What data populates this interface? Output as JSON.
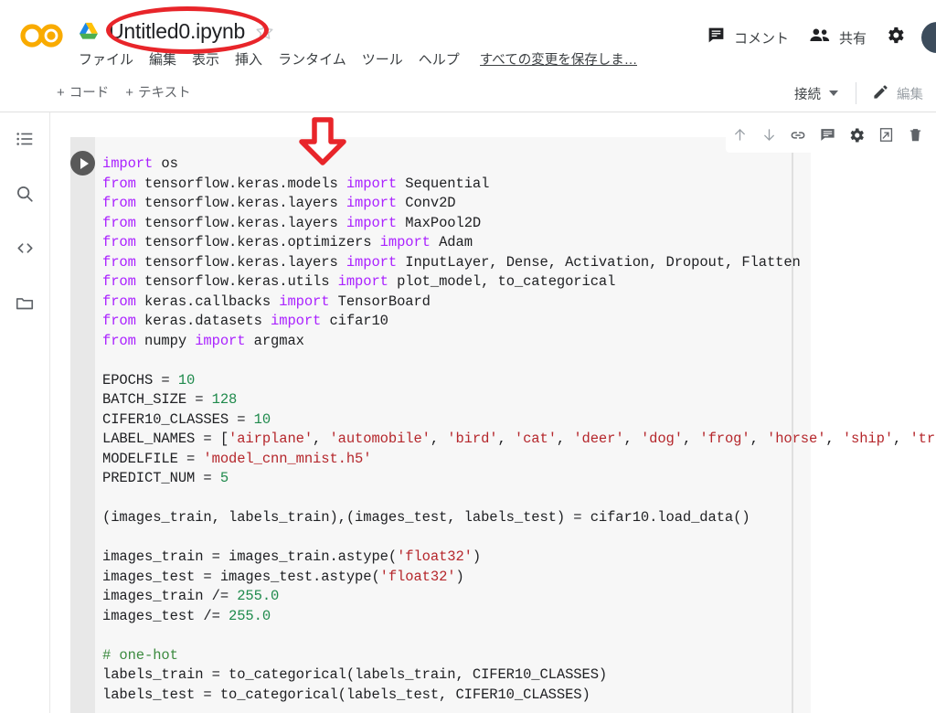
{
  "app": {
    "name": "Google Colaboratory",
    "logo_text": "CO"
  },
  "header": {
    "document_title": "Untitled0.ipynb",
    "drive_icon": "google-drive-icon",
    "star_icon": "star-outline-icon",
    "menu_items": [
      {
        "label": "ファイル"
      },
      {
        "label": "編集"
      },
      {
        "label": "表示"
      },
      {
        "label": "挿入"
      },
      {
        "label": "ランタイム"
      },
      {
        "label": "ツール"
      },
      {
        "label": "ヘルプ"
      }
    ],
    "save_status": "すべての変更を保存しま…",
    "comment_label": "コメント",
    "comment_icon": "comment-icon",
    "share_label": "共有",
    "share_icon": "people-icon",
    "settings_icon": "gear-icon",
    "avatar": "user-avatar"
  },
  "toolbar": {
    "add_code_label": "コード",
    "add_text_label": "テキスト",
    "plus": "+",
    "connect_label": "接続",
    "connect_caret": "chevron-down-icon",
    "edit_label": "編集",
    "edit_icon": "pencil-icon"
  },
  "sidebar": {
    "items": [
      {
        "name": "table-of-contents",
        "icon": "list-icon"
      },
      {
        "name": "find-and-replace",
        "icon": "search-icon"
      },
      {
        "name": "code-snippets",
        "icon": "code-brackets-icon"
      },
      {
        "name": "files",
        "icon": "folder-icon"
      }
    ]
  },
  "cell_toolbar": {
    "buttons": [
      {
        "name": "move-cell-up",
        "icon": "arrow-up-icon"
      },
      {
        "name": "move-cell-down",
        "icon": "arrow-down-icon"
      },
      {
        "name": "link-to-cell",
        "icon": "link-icon"
      },
      {
        "name": "add-comment",
        "icon": "comment-icon"
      },
      {
        "name": "cell-settings",
        "icon": "gear-icon"
      },
      {
        "name": "open-in-new-tab",
        "icon": "open-in-new-icon"
      },
      {
        "name": "delete-cell",
        "icon": "trash-icon"
      }
    ]
  },
  "cell": {
    "run_button": "run-cell-button",
    "code_lines": [
      [
        {
          "t": "import",
          "c": "kw"
        },
        {
          "t": " os",
          "c": ""
        }
      ],
      [
        {
          "t": "from",
          "c": "kw"
        },
        {
          "t": " tensorflow.keras.models ",
          "c": ""
        },
        {
          "t": "import",
          "c": "kw"
        },
        {
          "t": " Sequential",
          "c": ""
        }
      ],
      [
        {
          "t": "from",
          "c": "kw"
        },
        {
          "t": " tensorflow.keras.layers ",
          "c": ""
        },
        {
          "t": "import",
          "c": "kw"
        },
        {
          "t": " Conv2D",
          "c": ""
        }
      ],
      [
        {
          "t": "from",
          "c": "kw"
        },
        {
          "t": " tensorflow.keras.layers ",
          "c": ""
        },
        {
          "t": "import",
          "c": "kw"
        },
        {
          "t": " MaxPool2D",
          "c": ""
        }
      ],
      [
        {
          "t": "from",
          "c": "kw"
        },
        {
          "t": " tensorflow.keras.optimizers ",
          "c": ""
        },
        {
          "t": "import",
          "c": "kw"
        },
        {
          "t": " Adam",
          "c": ""
        }
      ],
      [
        {
          "t": "from",
          "c": "kw"
        },
        {
          "t": " tensorflow.keras.layers ",
          "c": ""
        },
        {
          "t": "import",
          "c": "kw"
        },
        {
          "t": " InputLayer, Dense, Activation, Dropout, Flatten",
          "c": ""
        }
      ],
      [
        {
          "t": "from",
          "c": "kw"
        },
        {
          "t": " tensorflow.keras.utils ",
          "c": ""
        },
        {
          "t": "import",
          "c": "kw"
        },
        {
          "t": " plot_model, to_categorical",
          "c": ""
        }
      ],
      [
        {
          "t": "from",
          "c": "kw"
        },
        {
          "t": " keras.callbacks ",
          "c": ""
        },
        {
          "t": "import",
          "c": "kw"
        },
        {
          "t": " TensorBoard",
          "c": ""
        }
      ],
      [
        {
          "t": "from",
          "c": "kw"
        },
        {
          "t": " keras.datasets ",
          "c": ""
        },
        {
          "t": "import",
          "c": "kw"
        },
        {
          "t": " cifar10",
          "c": ""
        }
      ],
      [
        {
          "t": "from",
          "c": "kw"
        },
        {
          "t": " numpy ",
          "c": ""
        },
        {
          "t": "import",
          "c": "kw"
        },
        {
          "t": " argmax",
          "c": ""
        }
      ],
      [
        {
          "t": "",
          "c": ""
        }
      ],
      [
        {
          "t": "EPOCHS = ",
          "c": ""
        },
        {
          "t": "10",
          "c": "num"
        }
      ],
      [
        {
          "t": "BATCH_SIZE = ",
          "c": ""
        },
        {
          "t": "128",
          "c": "num"
        }
      ],
      [
        {
          "t": "CIFER10_CLASSES = ",
          "c": ""
        },
        {
          "t": "10",
          "c": "num"
        }
      ],
      [
        {
          "t": "LABEL_NAMES = [",
          "c": ""
        },
        {
          "t": "'airplane'",
          "c": "str"
        },
        {
          "t": ", ",
          "c": ""
        },
        {
          "t": "'automobile'",
          "c": "str"
        },
        {
          "t": ", ",
          "c": ""
        },
        {
          "t": "'bird'",
          "c": "str"
        },
        {
          "t": ", ",
          "c": ""
        },
        {
          "t": "'cat'",
          "c": "str"
        },
        {
          "t": ", ",
          "c": ""
        },
        {
          "t": "'deer'",
          "c": "str"
        },
        {
          "t": ", ",
          "c": ""
        },
        {
          "t": "'dog'",
          "c": "str"
        },
        {
          "t": ", ",
          "c": ""
        },
        {
          "t": "'frog'",
          "c": "str"
        },
        {
          "t": ", ",
          "c": ""
        },
        {
          "t": "'horse'",
          "c": "str"
        },
        {
          "t": ", ",
          "c": ""
        },
        {
          "t": "'ship'",
          "c": "str"
        },
        {
          "t": ", ",
          "c": ""
        },
        {
          "t": "'truck'",
          "c": "str"
        },
        {
          "t": "]",
          "c": ""
        }
      ],
      [
        {
          "t": "MODELFILE = ",
          "c": ""
        },
        {
          "t": "'model_cnn_mnist.h5'",
          "c": "str"
        }
      ],
      [
        {
          "t": "PREDICT_NUM = ",
          "c": ""
        },
        {
          "t": "5",
          "c": "num"
        }
      ],
      [
        {
          "t": "",
          "c": ""
        }
      ],
      [
        {
          "t": "(images_train, labels_train),(images_test, labels_test) = cifar10.load_data()",
          "c": ""
        }
      ],
      [
        {
          "t": "",
          "c": ""
        }
      ],
      [
        {
          "t": "images_train = images_train.astype(",
          "c": ""
        },
        {
          "t": "'float32'",
          "c": "str"
        },
        {
          "t": ")",
          "c": ""
        }
      ],
      [
        {
          "t": "images_test = images_test.astype(",
          "c": ""
        },
        {
          "t": "'float32'",
          "c": "str"
        },
        {
          "t": ")",
          "c": ""
        }
      ],
      [
        {
          "t": "images_train /= ",
          "c": ""
        },
        {
          "t": "255.0",
          "c": "num"
        }
      ],
      [
        {
          "t": "images_test /= ",
          "c": ""
        },
        {
          "t": "255.0",
          "c": "num"
        }
      ],
      [
        {
          "t": "",
          "c": ""
        }
      ],
      [
        {
          "t": "# one-hot",
          "c": "cmt"
        }
      ],
      [
        {
          "t": "labels_train = to_categorical(labels_train, CIFER10_CLASSES)",
          "c": ""
        }
      ],
      [
        {
          "t": "labels_test = to_categorical(labels_test, CIFER10_CLASSES)",
          "c": ""
        }
      ]
    ]
  },
  "annotations": [
    {
      "name": "highlight-ellipse-filename",
      "shape": "ellipse",
      "color": "#e8252a"
    },
    {
      "name": "pointer-arrow-down",
      "shape": "arrow-down",
      "color": "#e8252a"
    }
  ],
  "colors": {
    "brand_orange": "#f9ab00",
    "annotation_red": "#e8252a",
    "keyword_purple": "#aa22ff",
    "number_green": "#1f8a4c",
    "string_red": "#b5272c",
    "comment_green": "#3d8b40",
    "cell_bg": "#f7f7f7",
    "gutter_bg": "#e8e8e8"
  }
}
